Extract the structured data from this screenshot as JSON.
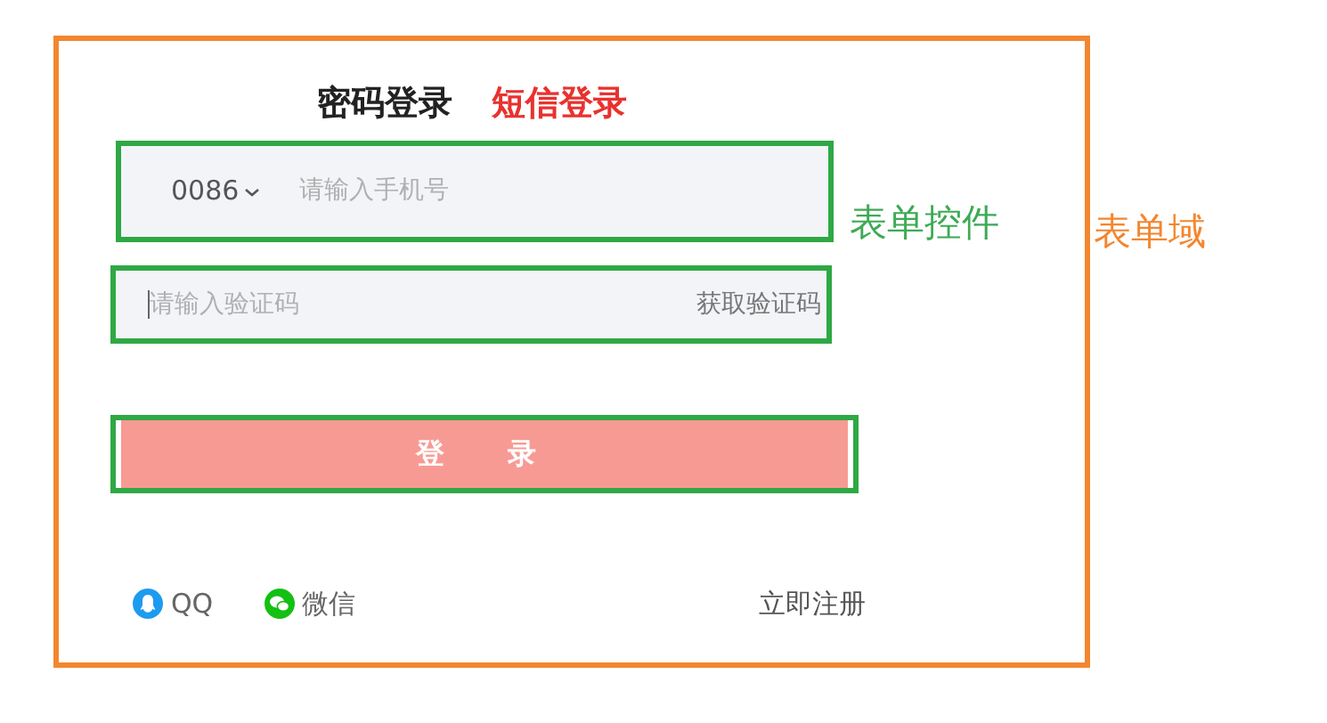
{
  "tabs": [
    {
      "label": "密码登录",
      "selected": false
    },
    {
      "label": "短信登录",
      "selected": true
    }
  ],
  "phone_field": {
    "country_code": "0086",
    "placeholder": "请输入手机号"
  },
  "code_field": {
    "placeholder": "请输入验证码",
    "action": "获取验证码"
  },
  "login_button": {
    "label": "登　录"
  },
  "social_logins": [
    {
      "kind": "qq",
      "label": "QQ"
    },
    {
      "kind": "wechat",
      "label": "微信"
    }
  ],
  "register_link": "立即注册",
  "annotations": {
    "controls": "表单控件",
    "form_area": "表单域"
  }
}
